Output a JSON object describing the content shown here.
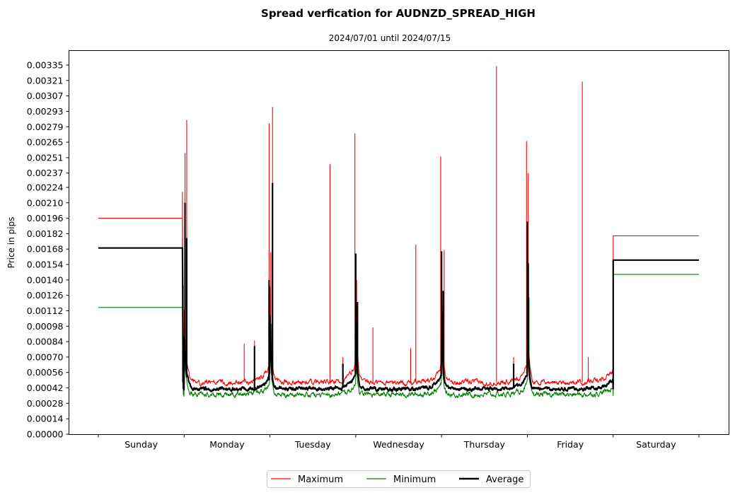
{
  "chart_data": {
    "type": "line",
    "title": "Spread verfication for AUDNZD_SPREAD_HIGH",
    "subtitle": "2024/07/01 until 2024/07/15",
    "xlabel": "",
    "ylabel": "Price in pips",
    "ylim": [
      0,
      0.00349
    ],
    "xlim": [
      -0.35,
      7.35
    ],
    "yticks": [
      "0.00000",
      "0.00014",
      "0.00028",
      "0.00042",
      "0.00056",
      "0.00070",
      "0.00084",
      "0.00098",
      "0.00112",
      "0.00126",
      "0.00140",
      "0.00154",
      "0.00168",
      "0.00182",
      "0.00196",
      "0.00210",
      "0.00224",
      "0.00237",
      "0.00251",
      "0.00265",
      "0.00279",
      "0.00293",
      "0.00307",
      "0.00321",
      "0.00335"
    ],
    "ytick_values": [
      0,
      0.00014,
      0.00028,
      0.00042,
      0.00056,
      0.0007,
      0.00084,
      0.00098,
      0.00112,
      0.00126,
      0.0014,
      0.00154,
      0.00168,
      0.00182,
      0.00196,
      0.0021,
      0.00224,
      0.00237,
      0.00251,
      0.00265,
      0.00279,
      0.00293,
      0.00307,
      0.00321,
      0.00335
    ],
    "xtick_positions": [
      0,
      1,
      2,
      3,
      4,
      5,
      6,
      7
    ],
    "categories": [
      "Sunday",
      "Monday",
      "Tuesday",
      "Wednesday",
      "Thursday",
      "Friday",
      "Saturday"
    ],
    "grid": false,
    "legend": {
      "placement": "bottom-center",
      "columns": 3
    },
    "series": [
      {
        "name": "Maximum",
        "color": "#ff0000",
        "sunday_level": 0.00196,
        "saturday_level": 0.0018,
        "baseline": 0.00047,
        "spikes": [
          {
            "x": 0.98,
            "value": 0.0022
          },
          {
            "x": 1.01,
            "value": 0.00255
          },
          {
            "x": 1.03,
            "value": 0.00285
          },
          {
            "x": 1.7,
            "value": 0.00082
          },
          {
            "x": 1.82,
            "value": 0.00085
          },
          {
            "x": 1.99,
            "value": 0.00282
          },
          {
            "x": 2.03,
            "value": 0.00297
          },
          {
            "x": 2.01,
            "value": 0.00165
          },
          {
            "x": 2.7,
            "value": 0.00245
          },
          {
            "x": 2.85,
            "value": 0.0007
          },
          {
            "x": 2.99,
            "value": 0.00273
          },
          {
            "x": 3.01,
            "value": 0.0014
          },
          {
            "x": 3.2,
            "value": 0.00097
          },
          {
            "x": 3.64,
            "value": 0.00078
          },
          {
            "x": 3.7,
            "value": 0.00172
          },
          {
            "x": 3.99,
            "value": 0.00252
          },
          {
            "x": 4.03,
            "value": 0.00167
          },
          {
            "x": 4.64,
            "value": 0.00334
          },
          {
            "x": 4.84,
            "value": 0.0007
          },
          {
            "x": 4.99,
            "value": 0.00266
          },
          {
            "x": 5.01,
            "value": 0.00237
          },
          {
            "x": 5.64,
            "value": 0.0032
          },
          {
            "x": 5.71,
            "value": 0.0007
          }
        ]
      },
      {
        "name": "Minimum",
        "color": "#008000",
        "sunday_level": 0.00115,
        "saturday_level": 0.00145,
        "baseline": 0.00036,
        "spikes": [
          {
            "x": 0.99,
            "value": 0.00135
          },
          {
            "x": 2.02,
            "value": 0.001
          },
          {
            "x": 3.01,
            "value": 0.001
          },
          {
            "x": 4.02,
            "value": 0.00098
          },
          {
            "x": 5.02,
            "value": 0.00124
          }
        ]
      },
      {
        "name": "Average",
        "color": "#000000",
        "sunday_level": 0.00169,
        "saturday_level": 0.00158,
        "baseline": 0.00041,
        "spikes": [
          {
            "x": 1.01,
            "value": 0.0021
          },
          {
            "x": 1.03,
            "value": 0.00178
          },
          {
            "x": 1.82,
            "value": 0.0008
          },
          {
            "x": 1.99,
            "value": 0.0014
          },
          {
            "x": 2.03,
            "value": 0.00228
          },
          {
            "x": 2.85,
            "value": 0.00064
          },
          {
            "x": 3.0,
            "value": 0.00164
          },
          {
            "x": 3.02,
            "value": 0.0012
          },
          {
            "x": 4.0,
            "value": 0.00166
          },
          {
            "x": 4.02,
            "value": 0.0013
          },
          {
            "x": 4.84,
            "value": 0.00064
          },
          {
            "x": 5.0,
            "value": 0.00193
          },
          {
            "x": 5.01,
            "value": 0.00155
          }
        ]
      }
    ]
  }
}
